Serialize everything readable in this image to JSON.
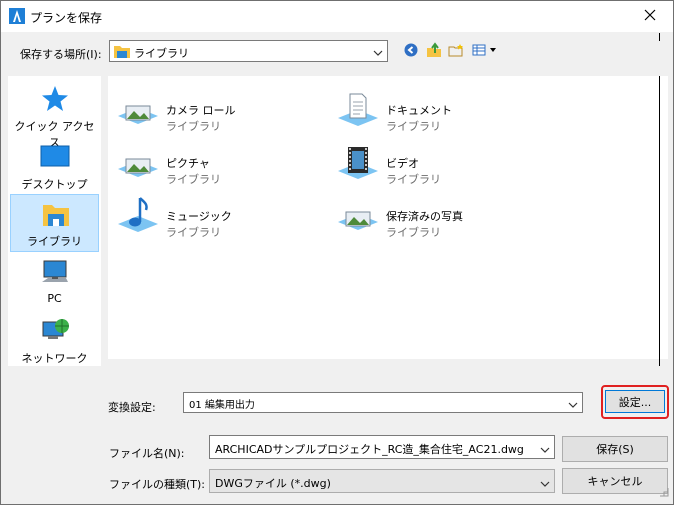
{
  "window": {
    "title": "プランを保存"
  },
  "location": {
    "label": "保存する場所(I):",
    "value": "ライブラリ"
  },
  "toolbar": {
    "icons": [
      "back-icon",
      "up-folder-icon",
      "new-folder-icon",
      "view-menu-icon"
    ]
  },
  "sidebar": {
    "items": [
      {
        "label": "クイック アクセス",
        "icon": "star-icon"
      },
      {
        "label": "デスクトップ",
        "icon": "desktop-icon"
      },
      {
        "label": "ライブラリ",
        "icon": "library-icon",
        "selected": true
      },
      {
        "label": "PC",
        "icon": "pc-icon"
      },
      {
        "label": "ネットワーク",
        "icon": "network-icon"
      }
    ]
  },
  "files": [
    {
      "name": "カメラ ロール",
      "sub": "ライブラリ",
      "icon": "picture-library-icon"
    },
    {
      "name": "ドキュメント",
      "sub": "ライブラリ",
      "icon": "documents-library-icon"
    },
    {
      "name": "ピクチャ",
      "sub": "ライブラリ",
      "icon": "pictures-library-icon"
    },
    {
      "name": "ビデオ",
      "sub": "ライブラリ",
      "icon": "videos-library-icon"
    },
    {
      "name": "ミュージック",
      "sub": "ライブラリ",
      "icon": "music-library-icon"
    },
    {
      "name": "保存済みの写真",
      "sub": "ライブラリ",
      "icon": "saved-pictures-library-icon"
    }
  ],
  "conversion": {
    "label": "変換設定:",
    "value": "01 編集用出力",
    "settings_button": "設定..."
  },
  "filename": {
    "label": "ファイル名(N):",
    "value": "ARCHICADサンプルプロジェクト_RC造_集合住宅_AC21.dwg"
  },
  "filetype": {
    "label": "ファイルの種類(T):",
    "value": "DWGファイル (*.dwg)"
  },
  "buttons": {
    "save": "保存(S)",
    "cancel": "キャンセル"
  },
  "colors": {
    "accent": "#0078d7",
    "highlight": "#e02020",
    "selection": "#cce8ff"
  }
}
